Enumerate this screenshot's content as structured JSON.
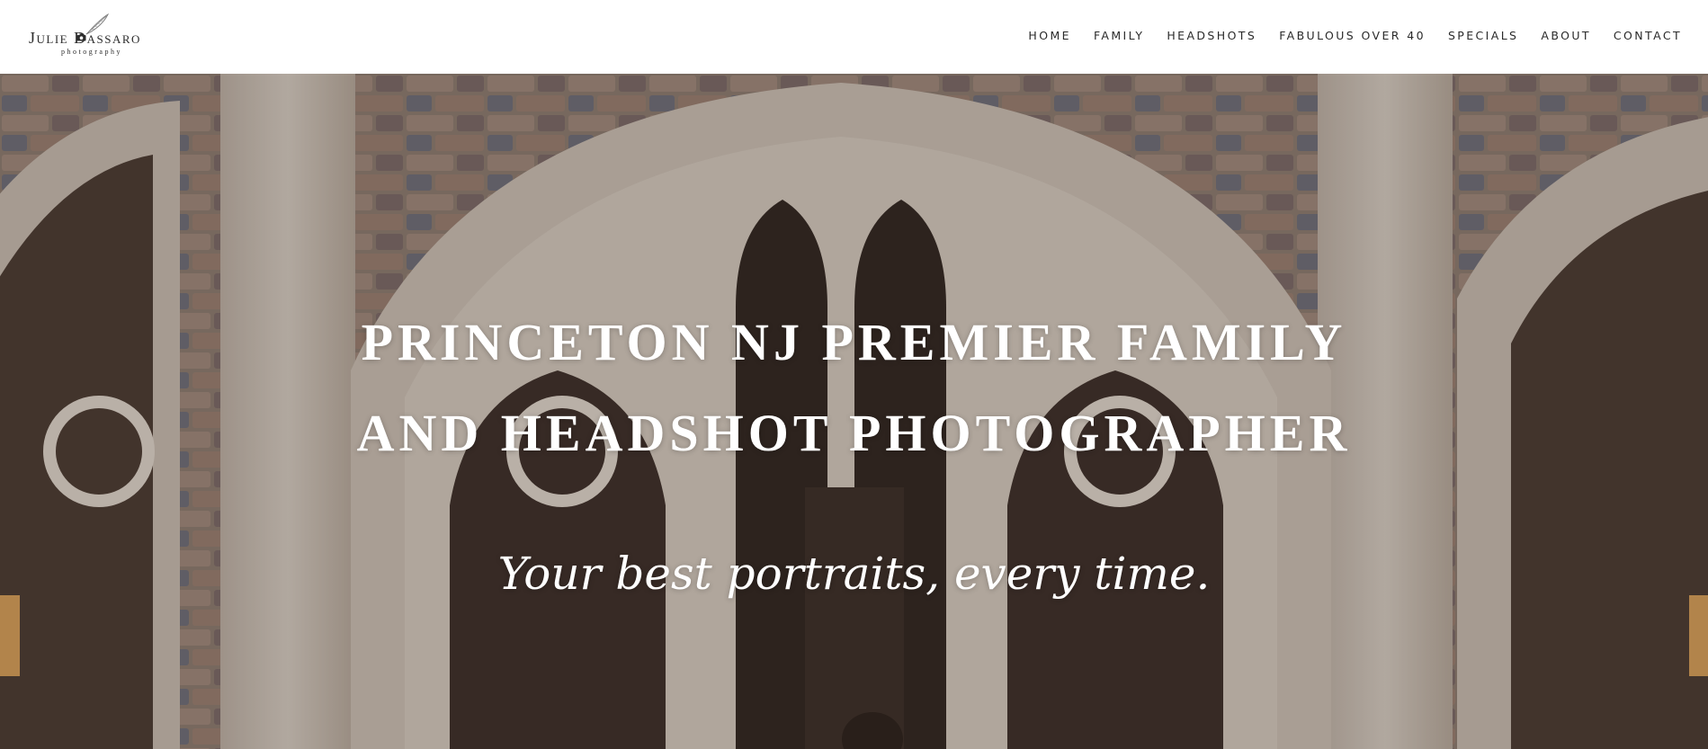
{
  "logo": {
    "name": "Julie Dassaro",
    "tagline": "photography"
  },
  "nav": {
    "items": [
      {
        "label": "HOME"
      },
      {
        "label": "FAMILY"
      },
      {
        "label": "HEADSHOTS"
      },
      {
        "label": "FABULOUS OVER 40"
      },
      {
        "label": "SPECIALS"
      },
      {
        "label": "ABOUT"
      },
      {
        "label": "CONTACT"
      }
    ]
  },
  "hero": {
    "title_line1": "PRINCETON NJ PREMIER FAMILY",
    "title_line2": "AND HEADSHOT PHOTOGRAPHER",
    "tagline": "Your best portraits, every time."
  },
  "colors": {
    "header_bg": "#ffffff",
    "nav_text": "#2a2a2a",
    "hero_text": "#ffffff",
    "stone": "#cfc6bd"
  },
  "icons": {
    "logo_camera": "camera-icon",
    "logo_feather": "feather-icon"
  }
}
